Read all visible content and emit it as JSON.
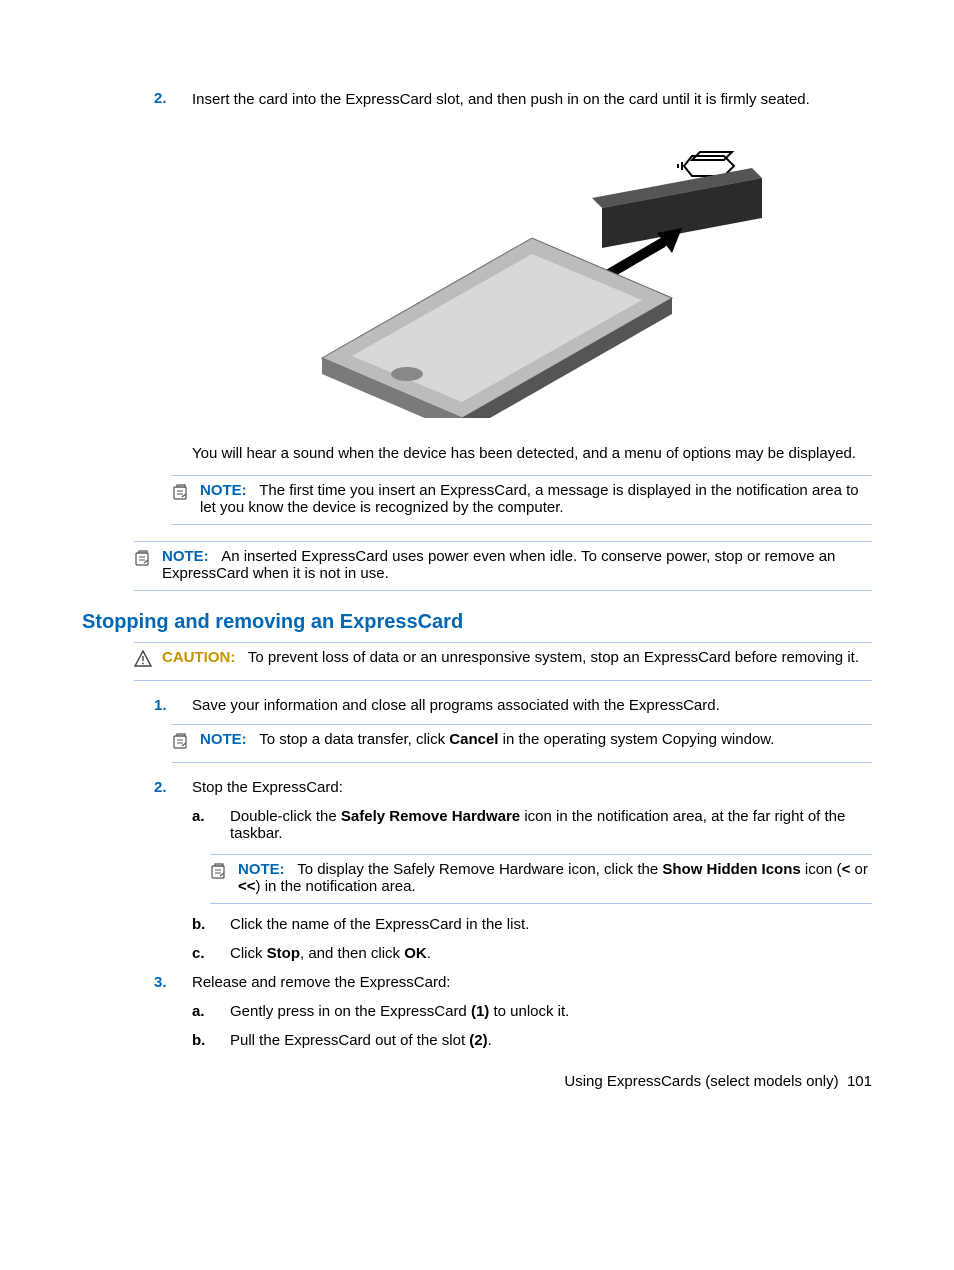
{
  "step2": {
    "num": "2.",
    "text": "Insert the card into the ExpressCard slot, and then push in on the card until it is firmly seated.",
    "after_fig": "You will hear a sound when the device has been detected, and a menu of options may be displayed."
  },
  "note_firsttime": {
    "label": "NOTE:",
    "text": "The first time you insert an ExpressCard, a message is displayed in the notification area to let you know the device is recognized by the computer."
  },
  "note_idle": {
    "label": "NOTE:",
    "text": "An inserted ExpressCard uses power even when idle. To conserve power, stop or remove an ExpressCard when it is not in use."
  },
  "heading": "Stopping and removing an ExpressCard",
  "caution": {
    "label": "CAUTION:",
    "text": "To prevent loss of data or an unresponsive system, stop an ExpressCard before removing it."
  },
  "s1": {
    "num": "1.",
    "text": "Save your information and close all programs associated with the ExpressCard."
  },
  "note_cancel": {
    "label": "NOTE:",
    "before": "To stop a data transfer, click ",
    "bold": "Cancel",
    "after": " in the operating system Copying window."
  },
  "s2": {
    "num": "2.",
    "text": "Stop the ExpressCard:",
    "a": {
      "num": "a.",
      "before": "Double-click the ",
      "bold": "Safely Remove Hardware",
      "after": " icon in the notification area, at the far right of the taskbar."
    },
    "note_show": {
      "label": "NOTE:",
      "before": "To display the Safely Remove Hardware icon, click the ",
      "bold": "Show Hidden Icons",
      "after1": " icon (",
      "lt": "<",
      "or": " or ",
      "ltlt": "<<",
      "after2": ") in the notification area."
    },
    "b": {
      "num": "b.",
      "text": "Click the name of the ExpressCard in the list."
    },
    "c": {
      "num": "c.",
      "before": "Click ",
      "b1": "Stop",
      "mid": ", and then click ",
      "b2": "OK",
      "after": "."
    }
  },
  "s3": {
    "num": "3.",
    "text": "Release and remove the ExpressCard:",
    "a": {
      "num": "a.",
      "before": "Gently press in on the ExpressCard ",
      "bold": "(1)",
      "after": " to unlock it."
    },
    "b": {
      "num": "b.",
      "before": "Pull the ExpressCard out of the slot ",
      "bold": "(2)",
      "after": "."
    }
  },
  "footer": {
    "text": "Using ExpressCards (select models only)",
    "page": "101"
  }
}
